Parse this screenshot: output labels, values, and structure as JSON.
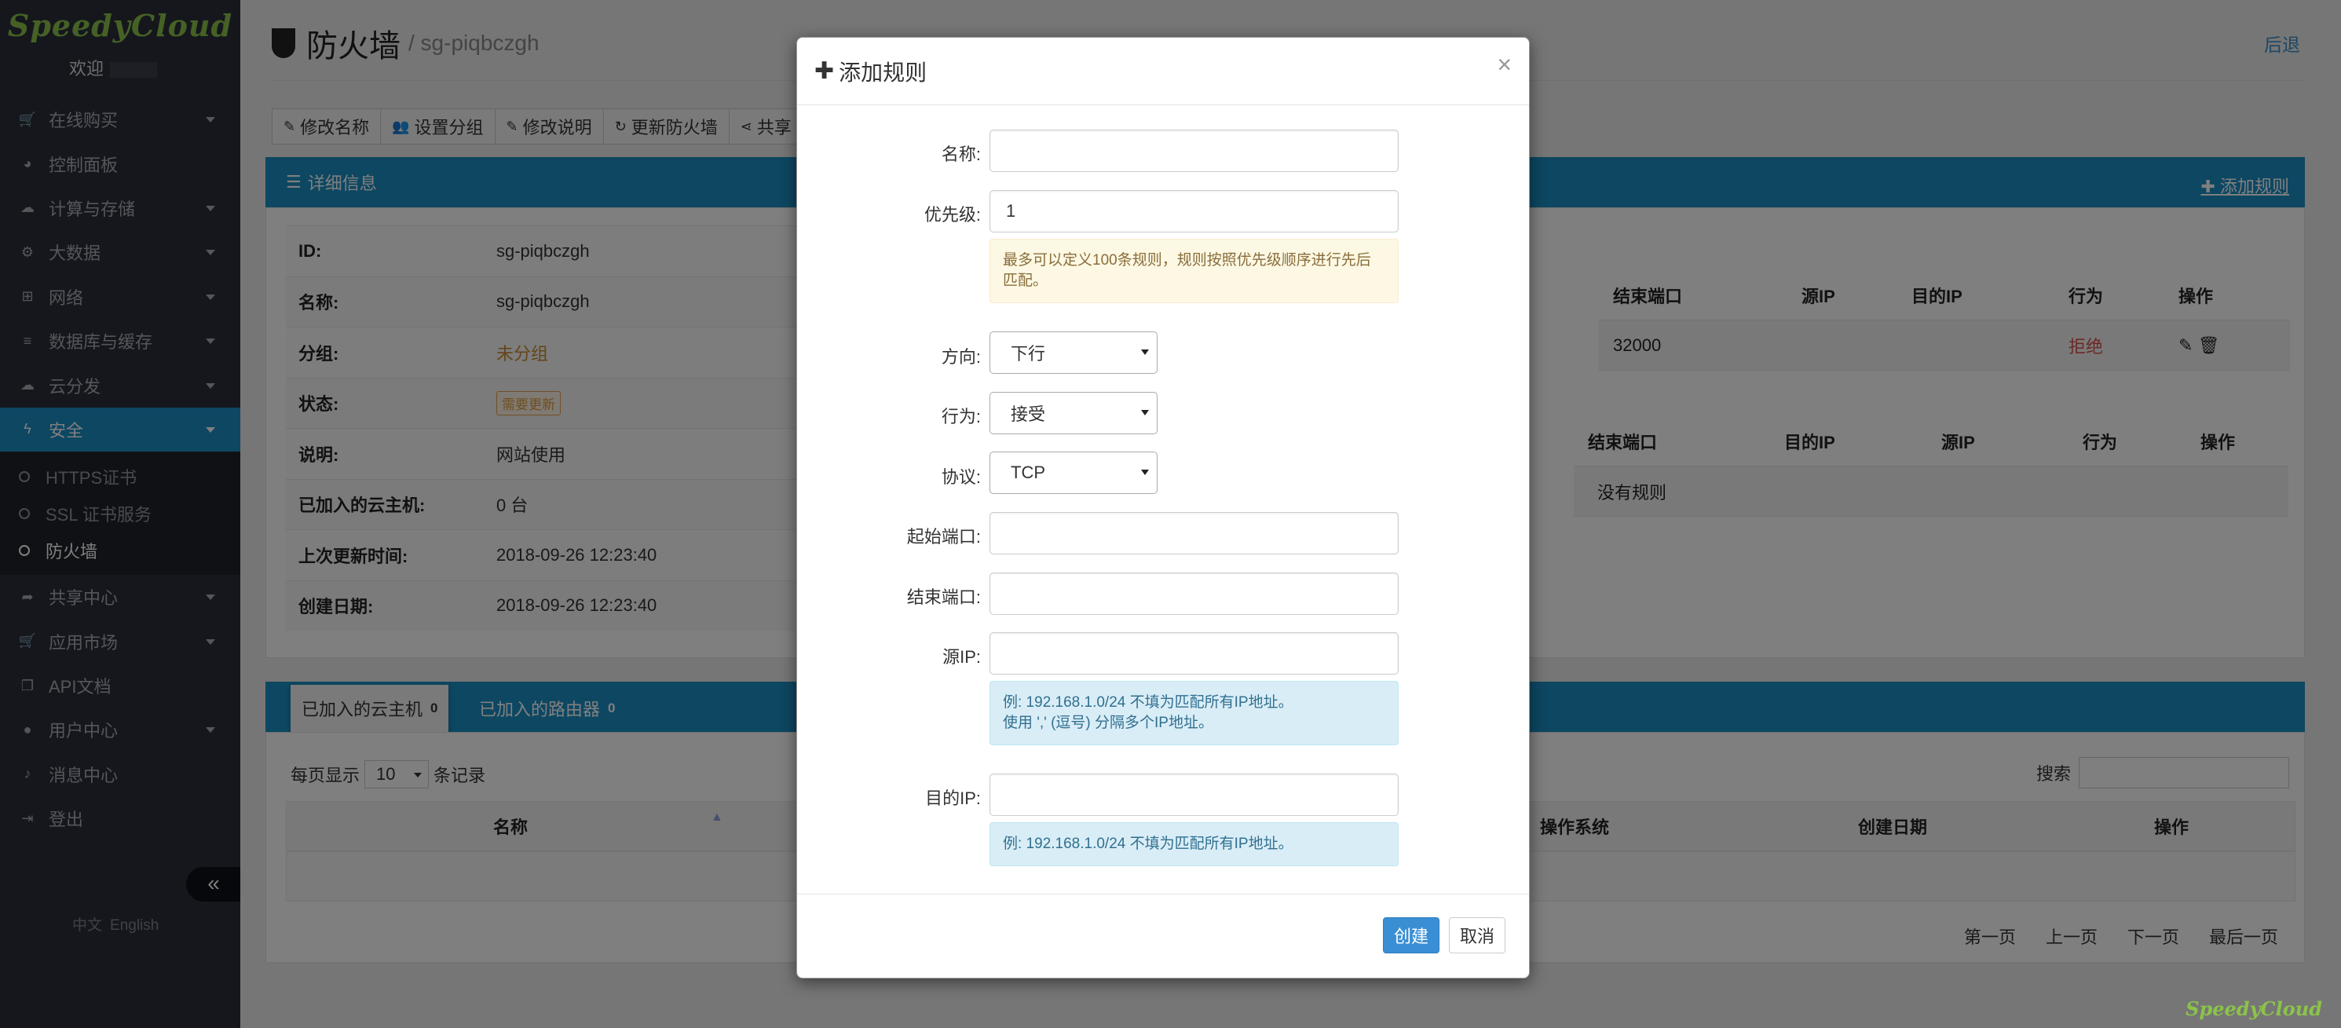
{
  "sidebar": {
    "logo": "SpeedyCloud",
    "welcome": "欢迎",
    "items": [
      {
        "label": "在线购买",
        "icon": "cart-icon"
      },
      {
        "label": "控制面板",
        "icon": "dashboard-icon"
      },
      {
        "label": "计算与存储",
        "icon": "cloud-icon"
      },
      {
        "label": "大数据",
        "icon": "gear-icon"
      },
      {
        "label": "网络",
        "icon": "sitemap-icon"
      },
      {
        "label": "数据库与缓存",
        "icon": "database-icon"
      },
      {
        "label": "云分发",
        "icon": "cloud-upload-icon"
      },
      {
        "label": "安全",
        "icon": "bolt-icon"
      }
    ],
    "sub_items": [
      {
        "label": "HTTPS证书"
      },
      {
        "label": "SSL 证书服务"
      },
      {
        "label": "防火墙"
      }
    ],
    "items_after": [
      {
        "label": "共享中心",
        "icon": "share-icon"
      },
      {
        "label": "应用市场",
        "icon": "cart-icon"
      },
      {
        "label": "API文档",
        "icon": "copy-icon"
      },
      {
        "label": "用户中心",
        "icon": "user-icon"
      },
      {
        "label": "消息中心",
        "icon": "bell-icon"
      },
      {
        "label": "登出",
        "icon": "sign-out-icon"
      }
    ],
    "collapse": "«",
    "lang_zh": "中文",
    "lang_en": "English"
  },
  "page": {
    "title": "防火墙",
    "subtitle": "/ sg-piqbczgh",
    "back": "后退"
  },
  "toolbar": {
    "rename": "修改名称",
    "group": "设置分组",
    "desc": "修改说明",
    "update": "更新防火墙",
    "share": "共享"
  },
  "detail": {
    "header": "详细信息",
    "add_rule": "添加规则",
    "rows": [
      {
        "k": "ID:",
        "v": "sg-piqbczgh"
      },
      {
        "k": "名称:",
        "v": "sg-piqbczgh"
      },
      {
        "k": "分组:",
        "v": "未分组"
      },
      {
        "k": "状态:",
        "v": "需要更新"
      },
      {
        "k": "说明:",
        "v": "网站使用"
      },
      {
        "k": "已加入的云主机:",
        "v": "0 台"
      },
      {
        "k": "上次更新时间:",
        "v": "2018-09-26 12:23:40"
      },
      {
        "k": "创建日期:",
        "v": "2018-09-26 12:23:40"
      }
    ]
  },
  "rules_in": {
    "headers": [
      "结束端口",
      "源IP",
      "目的IP",
      "行为",
      "操作"
    ],
    "row": [
      "32000",
      "",
      "",
      "拒绝",
      ""
    ]
  },
  "rules_out": {
    "headers": [
      "结束端口",
      "目的IP",
      "源IP",
      "行为",
      "操作"
    ],
    "empty": "没有规则"
  },
  "lower": {
    "tab_vm": "已加入的云主机",
    "tab_vm_count": "0",
    "tab_router": "已加入的路由器",
    "tab_router_count": "0",
    "per_page_pre": "每页显示",
    "per_page_value": "10",
    "per_page_post": "条记录",
    "search": "搜索",
    "headers": [
      "名称",
      "操作系统",
      "创建日期",
      "操作"
    ],
    "pager": [
      "第一页",
      "上一页",
      "下一页",
      "最后一页"
    ]
  },
  "modal": {
    "title": "添加规则",
    "close": "×",
    "name_label": "名称:",
    "name_value": "",
    "priority_label": "优先级:",
    "priority_value": "1",
    "priority_hint": "最多可以定义100条规则，规则按照优先级顺序进行先后匹配。",
    "direction_label": "方向:",
    "direction_value": "下行",
    "action_label": "行为:",
    "action_value": "接受",
    "protocol_label": "协议:",
    "protocol_value": "TCP",
    "start_port_label": "起始端口:",
    "end_port_label": "结束端口:",
    "src_ip_label": "源IP:",
    "src_ip_hint1": "例: 192.168.1.0/24 不填为匹配所有IP地址。",
    "src_ip_hint2": "使用 ',' (逗号) 分隔多个IP地址。",
    "dst_ip_label": "目的IP:",
    "dst_ip_hint": "例: 192.168.1.0/24 不填为匹配所有IP地址。",
    "create": "创建",
    "cancel": "取消"
  },
  "corner_logo": "SpeedyCloud"
}
